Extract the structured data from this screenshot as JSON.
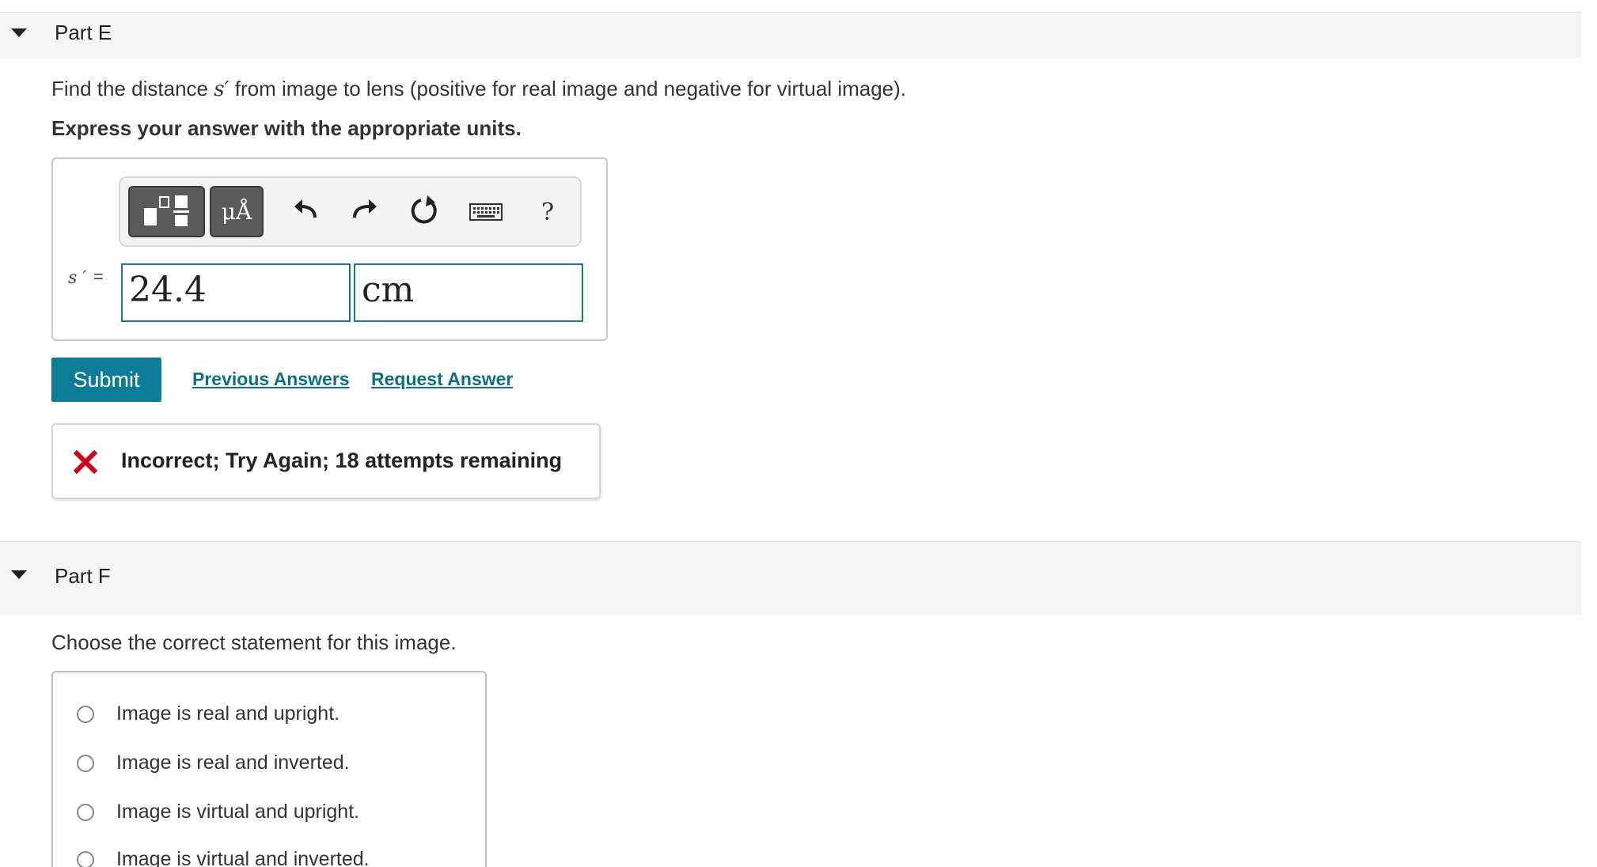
{
  "partE": {
    "title": "Part E",
    "prompt_before": "Find the distance",
    "prompt_symbol": "s′",
    "prompt_after": "from image to lens (positive for real image and negative for virtual image).",
    "instruction": "Express your answer with the appropriate units.",
    "toolbar": {
      "templates_icon": "templates-icon",
      "units_label": "μÅ",
      "undo_icon": "undo-icon",
      "redo_icon": "redo-icon",
      "reset_icon": "reset-icon",
      "keyboard_icon": "keyboard-icon",
      "help_label": "?"
    },
    "variable_label": "s ′",
    "equals": "=",
    "value": "24.4",
    "units": "cm",
    "submit_label": "Submit",
    "previous_answers_label": "Previous Answers",
    "request_answer_label": "Request Answer",
    "feedback": {
      "icon": "incorrect-x-icon",
      "message": "Incorrect; Try Again; 18 attempts remaining",
      "color": "#d0021b"
    }
  },
  "partF": {
    "title": "Part F",
    "prompt": "Choose the correct statement for this image.",
    "choices": [
      "Image is real and upright.",
      "Image is real and inverted.",
      "Image is virtual and upright.",
      "Image is virtual and inverted."
    ]
  },
  "colors": {
    "accent": "#0d7c99",
    "link": "#0b6f8c",
    "input_border": "#1a7a8c"
  }
}
